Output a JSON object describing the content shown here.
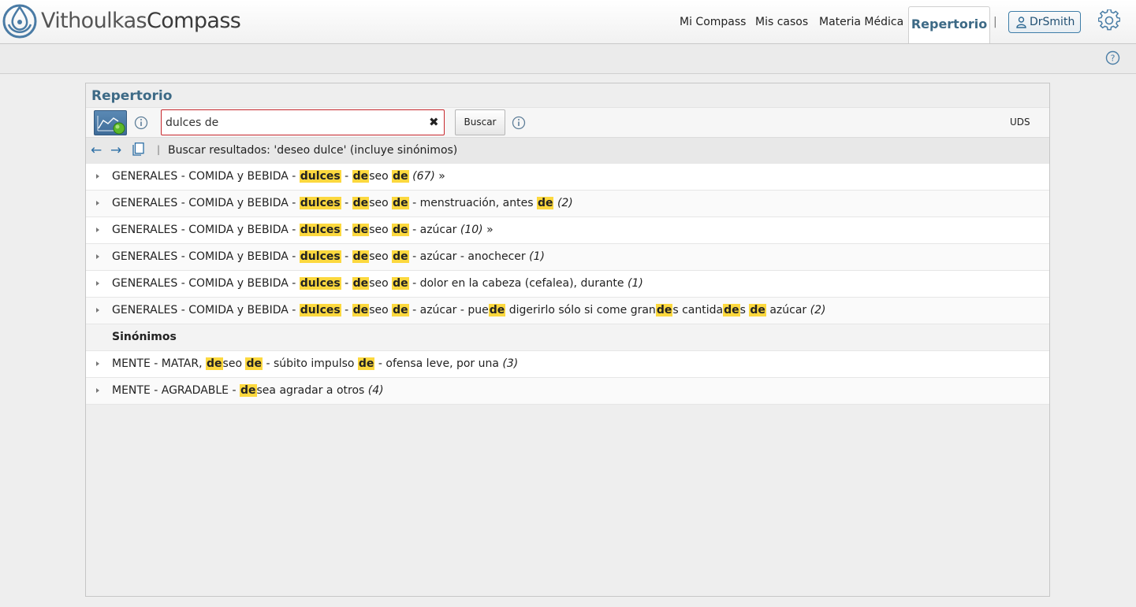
{
  "app": {
    "brand_regular": "Vithoulkas",
    "brand_bold": "Compass"
  },
  "nav": {
    "items": [
      {
        "label": "Mi Compass"
      },
      {
        "label": "Mis casos"
      },
      {
        "label": "Materia Médica"
      }
    ],
    "active": "Repertorio",
    "separator": "|",
    "user": "DrSmith"
  },
  "panel": {
    "title": "Repertorio",
    "search": {
      "value": "dulces de",
      "button": "Buscar"
    },
    "uds": "UDS",
    "results_header": {
      "separator": "|",
      "text": "Buscar resultados: 'deseo dulce' (incluye sinónimos)"
    },
    "results": [
      {
        "parts": [
          {
            "t": "GENERALES - COMIDA y BEBIDA - "
          },
          {
            "h": "dulces"
          },
          {
            "t": " - "
          },
          {
            "h": "de"
          },
          {
            "t": "seo "
          },
          {
            "h": "de"
          },
          {
            "t": " "
          },
          {
            "c": "(67)"
          },
          {
            "t": " »"
          }
        ]
      },
      {
        "parts": [
          {
            "t": "GENERALES - COMIDA y BEBIDA - "
          },
          {
            "h": "dulces"
          },
          {
            "t": " - "
          },
          {
            "h": "de"
          },
          {
            "t": "seo "
          },
          {
            "h": "de"
          },
          {
            "t": " - menstruación, antes "
          },
          {
            "h": "de"
          },
          {
            "t": " "
          },
          {
            "c": "(2)"
          }
        ]
      },
      {
        "parts": [
          {
            "t": "GENERALES - COMIDA y BEBIDA - "
          },
          {
            "h": "dulces"
          },
          {
            "t": " - "
          },
          {
            "h": "de"
          },
          {
            "t": "seo "
          },
          {
            "h": "de"
          },
          {
            "t": " - azúcar "
          },
          {
            "c": "(10)"
          },
          {
            "t": " »"
          }
        ]
      },
      {
        "parts": [
          {
            "t": "GENERALES - COMIDA y BEBIDA - "
          },
          {
            "h": "dulces"
          },
          {
            "t": " - "
          },
          {
            "h": "de"
          },
          {
            "t": "seo "
          },
          {
            "h": "de"
          },
          {
            "t": " - azúcar - anochecer "
          },
          {
            "c": "(1)"
          }
        ]
      },
      {
        "parts": [
          {
            "t": "GENERALES - COMIDA y BEBIDA - "
          },
          {
            "h": "dulces"
          },
          {
            "t": " - "
          },
          {
            "h": "de"
          },
          {
            "t": "seo "
          },
          {
            "h": "de"
          },
          {
            "t": " - dolor en la cabeza (cefalea), durante "
          },
          {
            "c": "(1)"
          }
        ]
      },
      {
        "parts": [
          {
            "t": "GENERALES - COMIDA y BEBIDA - "
          },
          {
            "h": "dulces"
          },
          {
            "t": " - "
          },
          {
            "h": "de"
          },
          {
            "t": "seo "
          },
          {
            "h": "de"
          },
          {
            "t": " - azúcar - pue"
          },
          {
            "h": "de"
          },
          {
            "t": " digerirlo sólo si come gran"
          },
          {
            "h": "de"
          },
          {
            "t": "s cantida"
          },
          {
            "h": "de"
          },
          {
            "t": "s "
          },
          {
            "h": "de"
          },
          {
            "t": " azúcar "
          },
          {
            "c": "(2)"
          }
        ]
      }
    ],
    "synonyms_label": "Sinónimos",
    "synonyms": [
      {
        "parts": [
          {
            "t": "MENTE - MATAR, "
          },
          {
            "h": "de"
          },
          {
            "t": "seo "
          },
          {
            "h": "de"
          },
          {
            "t": " - súbito impulso "
          },
          {
            "h": "de"
          },
          {
            "t": " - ofensa leve, por una "
          },
          {
            "c": "(3)"
          }
        ]
      },
      {
        "parts": [
          {
            "t": "MENTE - AGRADABLE - "
          },
          {
            "h": "de"
          },
          {
            "t": "sea agradar a otros "
          },
          {
            "c": "(4)"
          }
        ]
      }
    ]
  },
  "colors": {
    "accent": "#3d6a86",
    "highlight": "#fcd83e",
    "search_border": "#c8282d"
  }
}
